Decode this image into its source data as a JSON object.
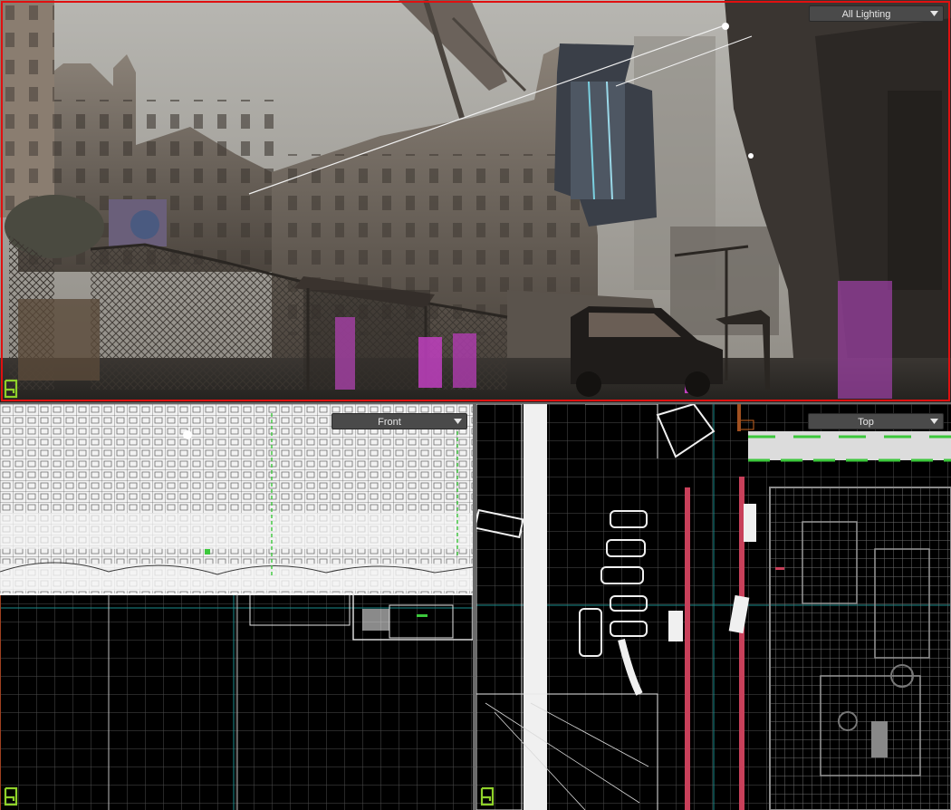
{
  "viewports": {
    "perspective": {
      "mode": "All Lighting",
      "active": true
    },
    "front": {
      "mode": "Front"
    },
    "top": {
      "mode": "Top"
    }
  },
  "colors": {
    "active_border": "#e01010",
    "grid_line": "#5a5a5a",
    "axis_line": "#1a8c8c",
    "wire": "#e8e8e8",
    "brush_green": "#3cc83c",
    "trigger_red": "#c8405a",
    "corner_glyph": "#8fd12a"
  },
  "icons": {
    "corner_glyph": "hammer-logo-icon",
    "dropdown_arrow": "chevron-down-icon"
  }
}
